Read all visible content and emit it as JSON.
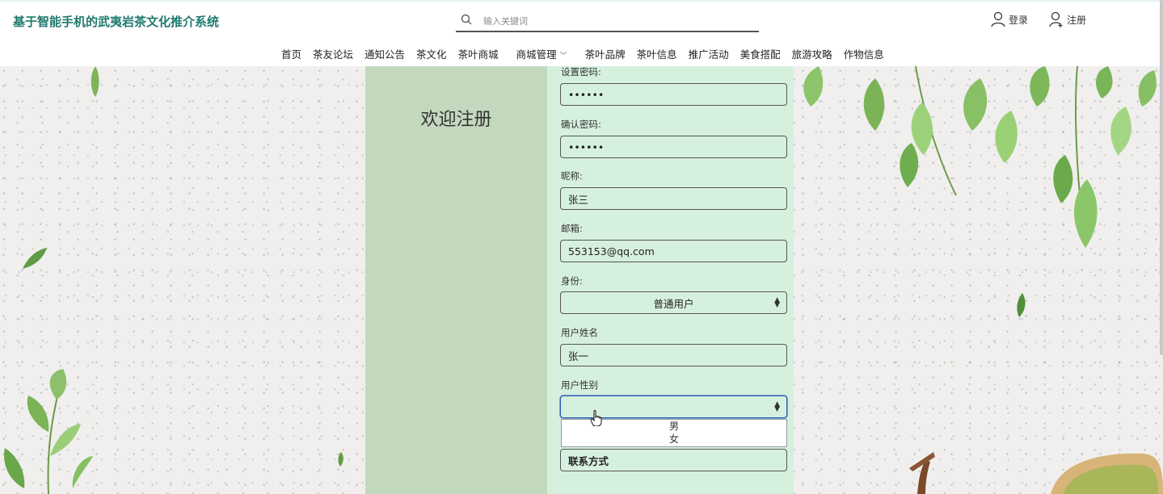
{
  "header": {
    "site_title": "基于智能手机的武夷岩茶文化推介系统",
    "search_placeholder": "输入关键词",
    "login_label": "登录",
    "register_label": "注册"
  },
  "nav": {
    "items": [
      "首页",
      "茶友论坛",
      "通知公告",
      "茶文化",
      "茶叶商城",
      "商城管理",
      "茶叶品牌",
      "茶叶信息",
      "推广活动",
      "美食搭配",
      "旅游攻略",
      "作物信息"
    ]
  },
  "register": {
    "welcome": "欢迎注册",
    "password_label": "设置密码:",
    "password_value": "••••••",
    "confirm_label": "确认密码:",
    "confirm_value": "••••••",
    "nickname_label": "昵称:",
    "nickname_value": "张三",
    "email_label": "邮箱:",
    "email_value": "553153@qq.com",
    "role_label": "身份:",
    "role_value": "普通用户",
    "username_label": "用户姓名",
    "username_value": "张一",
    "gender_label": "用户性别",
    "gender_value": "",
    "gender_options": [
      "男",
      "女"
    ],
    "contact_value": "联系方式"
  },
  "colors": {
    "title": "#1f7a6e",
    "panel_left": "#c3d9be",
    "panel_right": "#d6f0de"
  }
}
